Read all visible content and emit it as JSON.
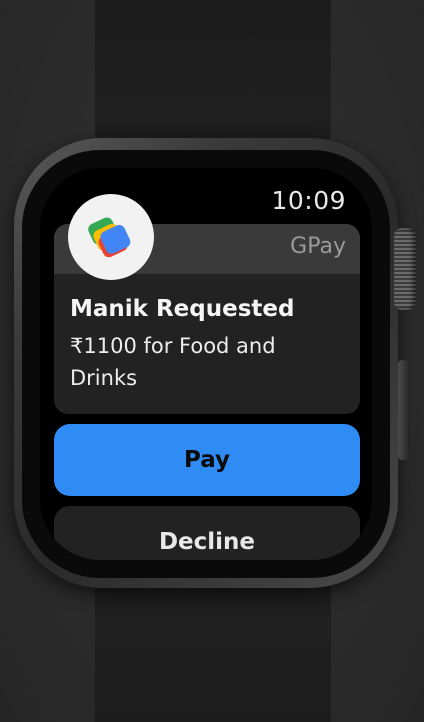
{
  "status_bar": {
    "time": "10:09"
  },
  "notification": {
    "app_name": "GPay",
    "app_icon": "gpay-logo-icon",
    "title": "Manik Requested",
    "body": "₹1100 for Food and Drinks"
  },
  "actions": {
    "pay_label": "Pay",
    "decline_label": "Decline"
  },
  "colors": {
    "pay_button": "#2f8cf5",
    "card_background": "#222222",
    "card_header": "#3a3a3a",
    "screen_background": "#000000"
  }
}
